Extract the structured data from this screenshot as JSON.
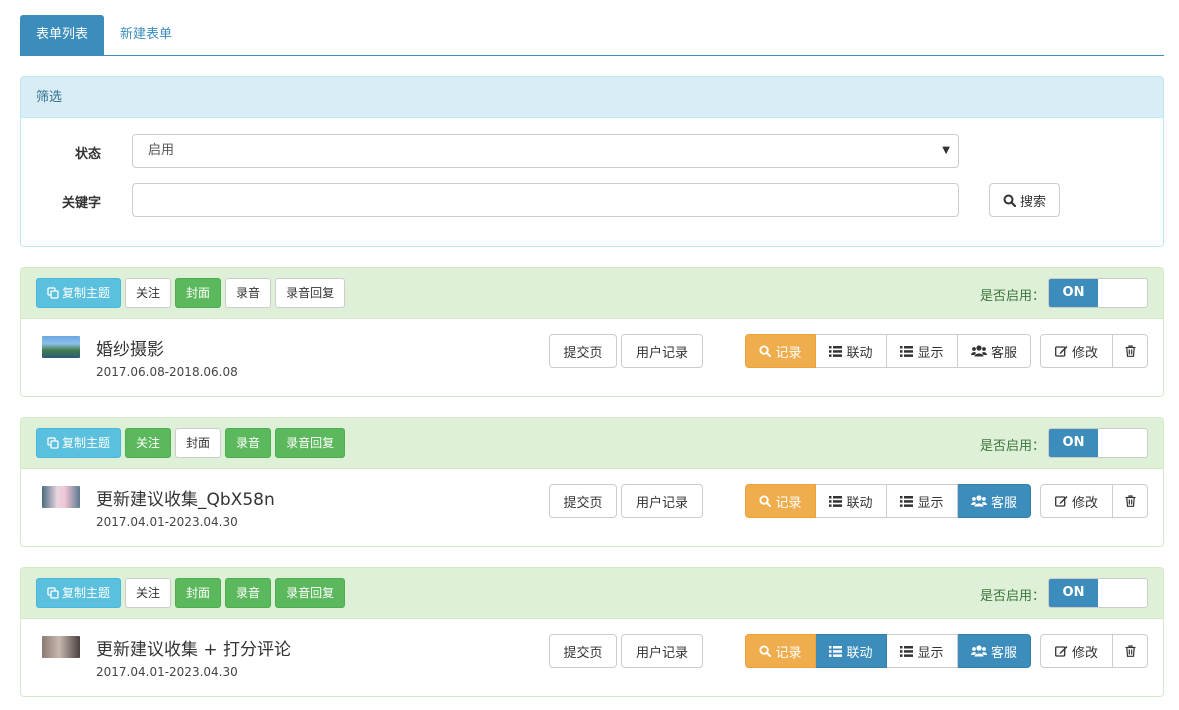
{
  "tabs": [
    {
      "label": "表单列表",
      "active": true
    },
    {
      "label": "新建表单",
      "active": false
    }
  ],
  "filter": {
    "title": "筛选",
    "status_label": "状态",
    "status_value": "启用",
    "keyword_label": "关键字",
    "keyword_value": "",
    "search_label": "搜索"
  },
  "card_common": {
    "enable_label": "是否启用：",
    "toggle_on": "ON",
    "copy_theme": "复制主题",
    "follow": "关注",
    "cover": "封面",
    "recording": "录音",
    "recording_reply": "录音回复",
    "submit_page": "提交页",
    "user_records": "用户记录",
    "records": "记录",
    "linkage": "联动",
    "display": "显示",
    "service": "客服",
    "edit": "修改"
  },
  "cards": [
    {
      "title": "婚纱摄影",
      "date": "2017.06.08-2018.06.08",
      "follow_active": false,
      "cover_active": true,
      "recording_active": false,
      "recording_reply_active": false,
      "linkage_active": false,
      "service_active": false
    },
    {
      "title": "更新建议收集_QbX58n",
      "date": "2017.04.01-2023.04.30",
      "follow_active": true,
      "cover_active": false,
      "recording_active": true,
      "recording_reply_active": true,
      "linkage_active": false,
      "service_active": true
    },
    {
      "title": "更新建议收集 + 打分评论",
      "date": "2017.04.01-2023.04.30",
      "follow_active": false,
      "cover_active": true,
      "recording_active": true,
      "recording_reply_active": true,
      "linkage_active": true,
      "service_active": true
    }
  ],
  "colors": {
    "primary": "#3c8dbc",
    "success": "#5cb85c",
    "info": "#5bc0de",
    "warning": "#f0ad4e",
    "panel_green": "#dff0d8",
    "panel_blue": "#d9edf7"
  }
}
